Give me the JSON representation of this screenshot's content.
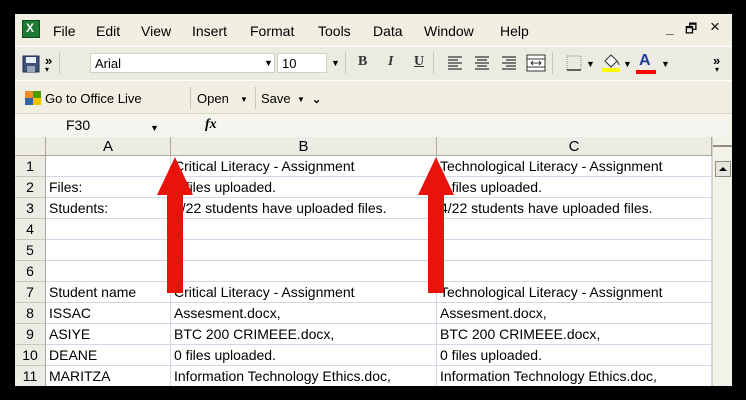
{
  "menu": {
    "items": [
      "File",
      "Edit",
      "View",
      "Insert",
      "Format",
      "Tools",
      "Data",
      "Window",
      "Help"
    ],
    "window_controls": {
      "minimize": "_",
      "restore": "🗗",
      "close": "×"
    }
  },
  "toolbar": {
    "font_name": "Arial",
    "font_size": "10",
    "bold": "B",
    "italic": "I",
    "underline": "U",
    "font_color_label": "A",
    "overflow": "»"
  },
  "livebar": {
    "office_live": "Go to Office Live",
    "open": "Open",
    "save": "Save"
  },
  "formula": {
    "cell_ref": "F30",
    "fx": "fx"
  },
  "sheet": {
    "columns": [
      "A",
      "B",
      "C"
    ],
    "rows": [
      {
        "num": "1",
        "cells": [
          "",
          "Critical Literacy - Assignment",
          "Technological Literacy - Assignment"
        ]
      },
      {
        "num": "2",
        "cells": [
          "Files:",
          "3 files uploaded.",
          "4 files uploaded."
        ]
      },
      {
        "num": "3",
        "cells": [
          "Students:",
          "3/22 students have uploaded files.",
          "4/22 students have uploaded files."
        ]
      },
      {
        "num": "4",
        "cells": [
          "",
          "",
          ""
        ]
      },
      {
        "num": "5",
        "cells": [
          "",
          "",
          ""
        ]
      },
      {
        "num": "6",
        "cells": [
          "",
          "",
          ""
        ]
      },
      {
        "num": "7",
        "cells": [
          "Student name",
          "Critical Literacy - Assignment",
          "Technological Literacy - Assignment"
        ]
      },
      {
        "num": "8",
        "cells": [
          "ISSAC",
          "Assesment.docx,",
          "Assesment.docx,"
        ]
      },
      {
        "num": "9",
        "cells": [
          "ASIYE",
          "BTC 200 CRIMEEE.docx,",
          "BTC 200 CRIMEEE.docx,"
        ]
      },
      {
        "num": "10",
        "cells": [
          "DEANE",
          "0 files uploaded.",
          "0 files uploaded."
        ]
      },
      {
        "num": "11",
        "cells": [
          "MARITZA",
          "Information Technology Ethics.doc,",
          "Information Technology Ethics.doc,"
        ]
      }
    ]
  },
  "colors": {
    "arrow": "#e8140c",
    "excel_green": "#1f7a33"
  }
}
